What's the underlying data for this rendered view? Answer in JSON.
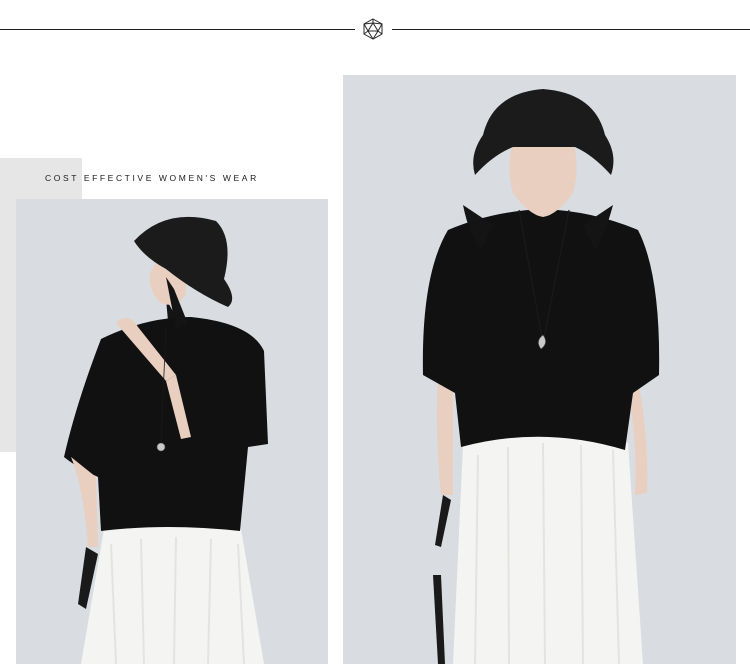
{
  "header": {
    "emblem_icon": "geometric-polyhedron-icon",
    "line_color": "#1e1e1e"
  },
  "tagline": "COST EFFECTIVE WOMEN'S WEAR",
  "colors": {
    "background": "#ffffff",
    "accent_block": "#e6e6e6",
    "photo_backdrop": "#d9dce1",
    "garment_top": "#111111",
    "garment_skirt": "#f4f4f2"
  },
  "photos": [
    {
      "id": "side-pose",
      "subject": "model in black bucket hat, black half-sleeve top, white lace skirt"
    },
    {
      "id": "front-pose",
      "subject": "model in black bucket hat, black half-sleeve top with heart pendant, white lace skirt"
    }
  ]
}
